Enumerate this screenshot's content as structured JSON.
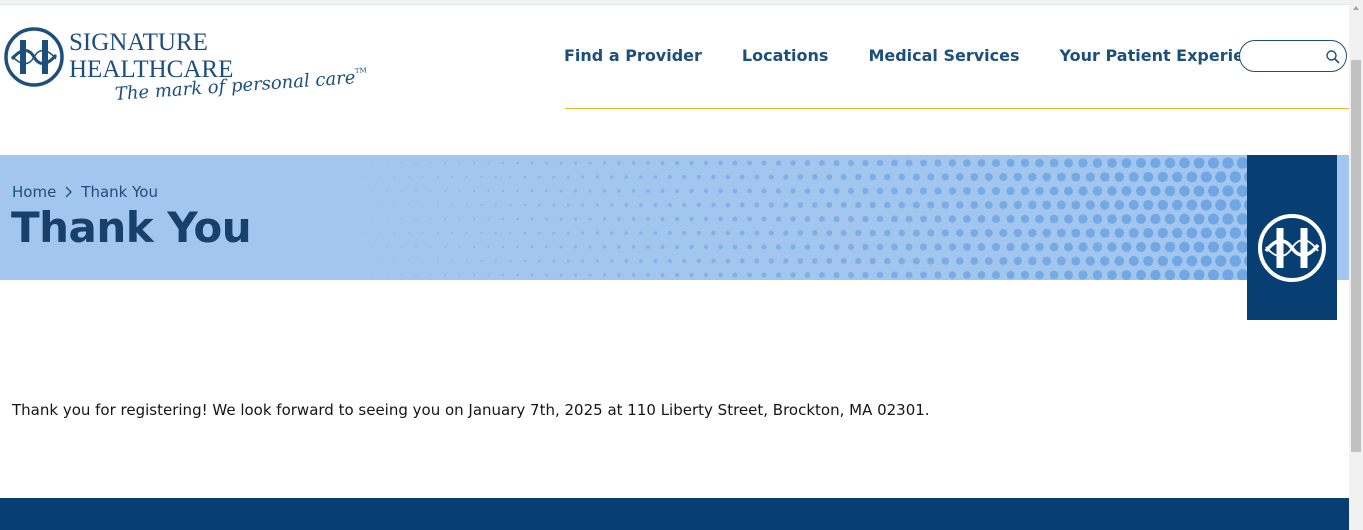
{
  "brand": {
    "line1": "SIGNATURE",
    "line2": "HEALTHCARE",
    "tagline": "The mark of personal care",
    "trademark": "TM",
    "logo_icon": "signature-h-logo-icon"
  },
  "nav": {
    "items": [
      {
        "label": "Find a Provider"
      },
      {
        "label": "Locations"
      },
      {
        "label": "Medical Services"
      },
      {
        "label": "Your Patient Experience"
      }
    ],
    "search": {
      "value": "",
      "placeholder": ""
    }
  },
  "banner": {
    "breadcrumb": [
      {
        "label": "Home"
      },
      {
        "label": "Thank You"
      }
    ],
    "title": "Thank You"
  },
  "content": {
    "message": "Thank you for registering! We look forward to seeing you on January 7th, 2025 at 110 Liberty Street, Brockton, MA 02301."
  },
  "colors": {
    "brand_navy": "#083f73",
    "nav_text": "#1d4f7c",
    "banner_bg": "#a3c6ee",
    "banner_dots": "#6ea5e4",
    "accent_rule": "#e8b923"
  }
}
